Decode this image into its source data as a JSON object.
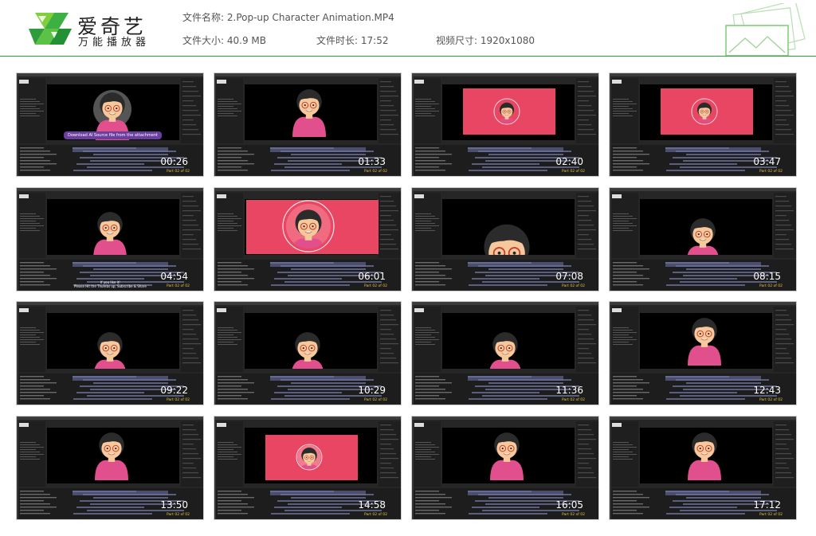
{
  "header": {
    "logo_title": "爱奇艺",
    "logo_subtitle": "万能播放器",
    "file_name_label": "文件名称:",
    "file_name": "2.Pop-up Character Animation.MP4",
    "file_size_label": "文件大小:",
    "file_size": "40.9 MB",
    "duration_label": "文件时长:",
    "duration": "17:52",
    "dimensions_label": "视频尺寸:",
    "dimensions": "1920x1080",
    "accent_color": "#2f9e3a"
  },
  "overlay": {
    "part_label": "Part 02 of 02",
    "annotation": "Download AI Source file from the attachment",
    "subscribe_line1": "If you like it!",
    "subscribe_line2": "Please Hit the Thumbs up, Subscribe & Share"
  },
  "thumbnails": [
    {
      "time": "00:26",
      "scene": "bubble"
    },
    {
      "time": "01:33",
      "scene": "full"
    },
    {
      "time": "02:40",
      "scene": "pink-small"
    },
    {
      "time": "03:47",
      "scene": "pink-small"
    },
    {
      "time": "04:54",
      "scene": "mid"
    },
    {
      "time": "06:01",
      "scene": "pink-big"
    },
    {
      "time": "07:08",
      "scene": "peek"
    },
    {
      "time": "08:15",
      "scene": "low"
    },
    {
      "time": "09:22",
      "scene": "low"
    },
    {
      "time": "10:29",
      "scene": "low"
    },
    {
      "time": "11:36",
      "scene": "low"
    },
    {
      "time": "12:43",
      "scene": "full"
    },
    {
      "time": "13:50",
      "scene": "full"
    },
    {
      "time": "14:58",
      "scene": "pink-mid"
    },
    {
      "time": "16:05",
      "scene": "full"
    },
    {
      "time": "17:12",
      "scene": "full"
    }
  ],
  "colors": {
    "pink_bg": "#e84663",
    "shirt": "#e24f8d",
    "skin": "#f6c89b",
    "hair": "#2b2b2b",
    "panel": "#262626",
    "comp": "#000000"
  }
}
